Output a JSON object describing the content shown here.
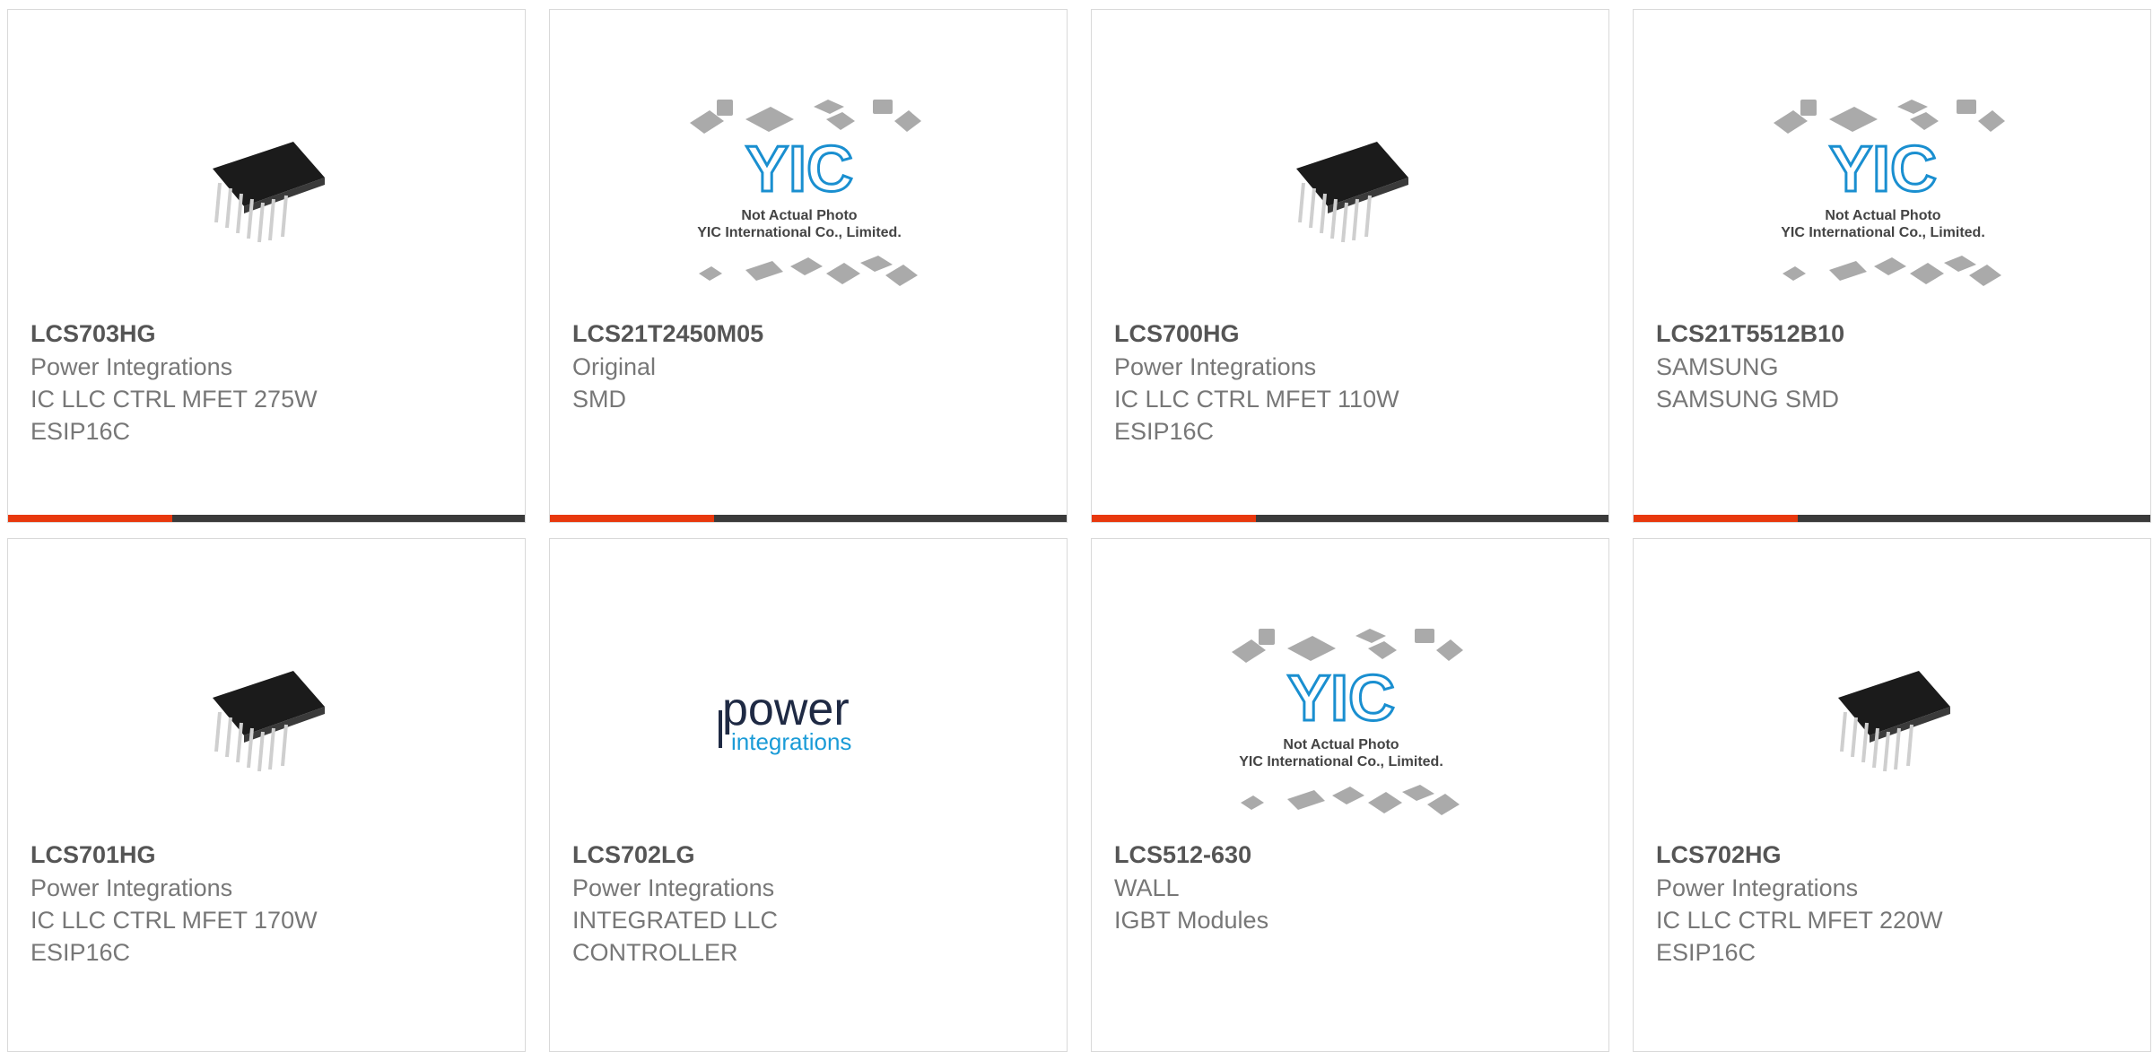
{
  "accent_color": "#e8380d",
  "bar_color": "#3a3a3a",
  "products": [
    {
      "part": "LCS703HG",
      "lines": [
        "Power Integrations",
        "IC LLC CTRL MFET 275W",
        "ESIP16C"
      ],
      "image": "chip-esip16c"
    },
    {
      "part": "LCS21T2450M05",
      "lines": [
        "Original",
        "SMD",
        ""
      ],
      "image": "yic-placeholder"
    },
    {
      "part": "LCS700HG",
      "lines": [
        "Power Integrations",
        "IC LLC CTRL MFET 110W",
        "ESIP16C"
      ],
      "image": "chip-esip16c"
    },
    {
      "part": "LCS21T5512B10",
      "lines": [
        "SAMSUNG",
        "SAMSUNG SMD",
        ""
      ],
      "image": "yic-placeholder"
    },
    {
      "part": "LCS701HG",
      "lines": [
        "Power Integrations",
        "IC LLC CTRL MFET 170W",
        "ESIP16C"
      ],
      "image": "chip-esip16c"
    },
    {
      "part": "LCS702LG",
      "lines": [
        "Power Integrations",
        "INTEGRATED LLC",
        "CONTROLLER"
      ],
      "image": "power-integrations-logo"
    },
    {
      "part": "LCS512-630",
      "lines": [
        "WALL",
        "IGBT Modules",
        ""
      ],
      "image": "yic-placeholder"
    },
    {
      "part": "LCS702HG",
      "lines": [
        "Power Integrations",
        "IC LLC CTRL MFET 220W",
        "ESIP16C"
      ],
      "image": "chip-esip16c"
    }
  ],
  "placeholder": {
    "logo_text": "YIC",
    "line1": "Not Actual Photo",
    "line2": "YIC International Co., Limited."
  },
  "brand_logo": {
    "word1": "power",
    "word2": "integrations"
  }
}
